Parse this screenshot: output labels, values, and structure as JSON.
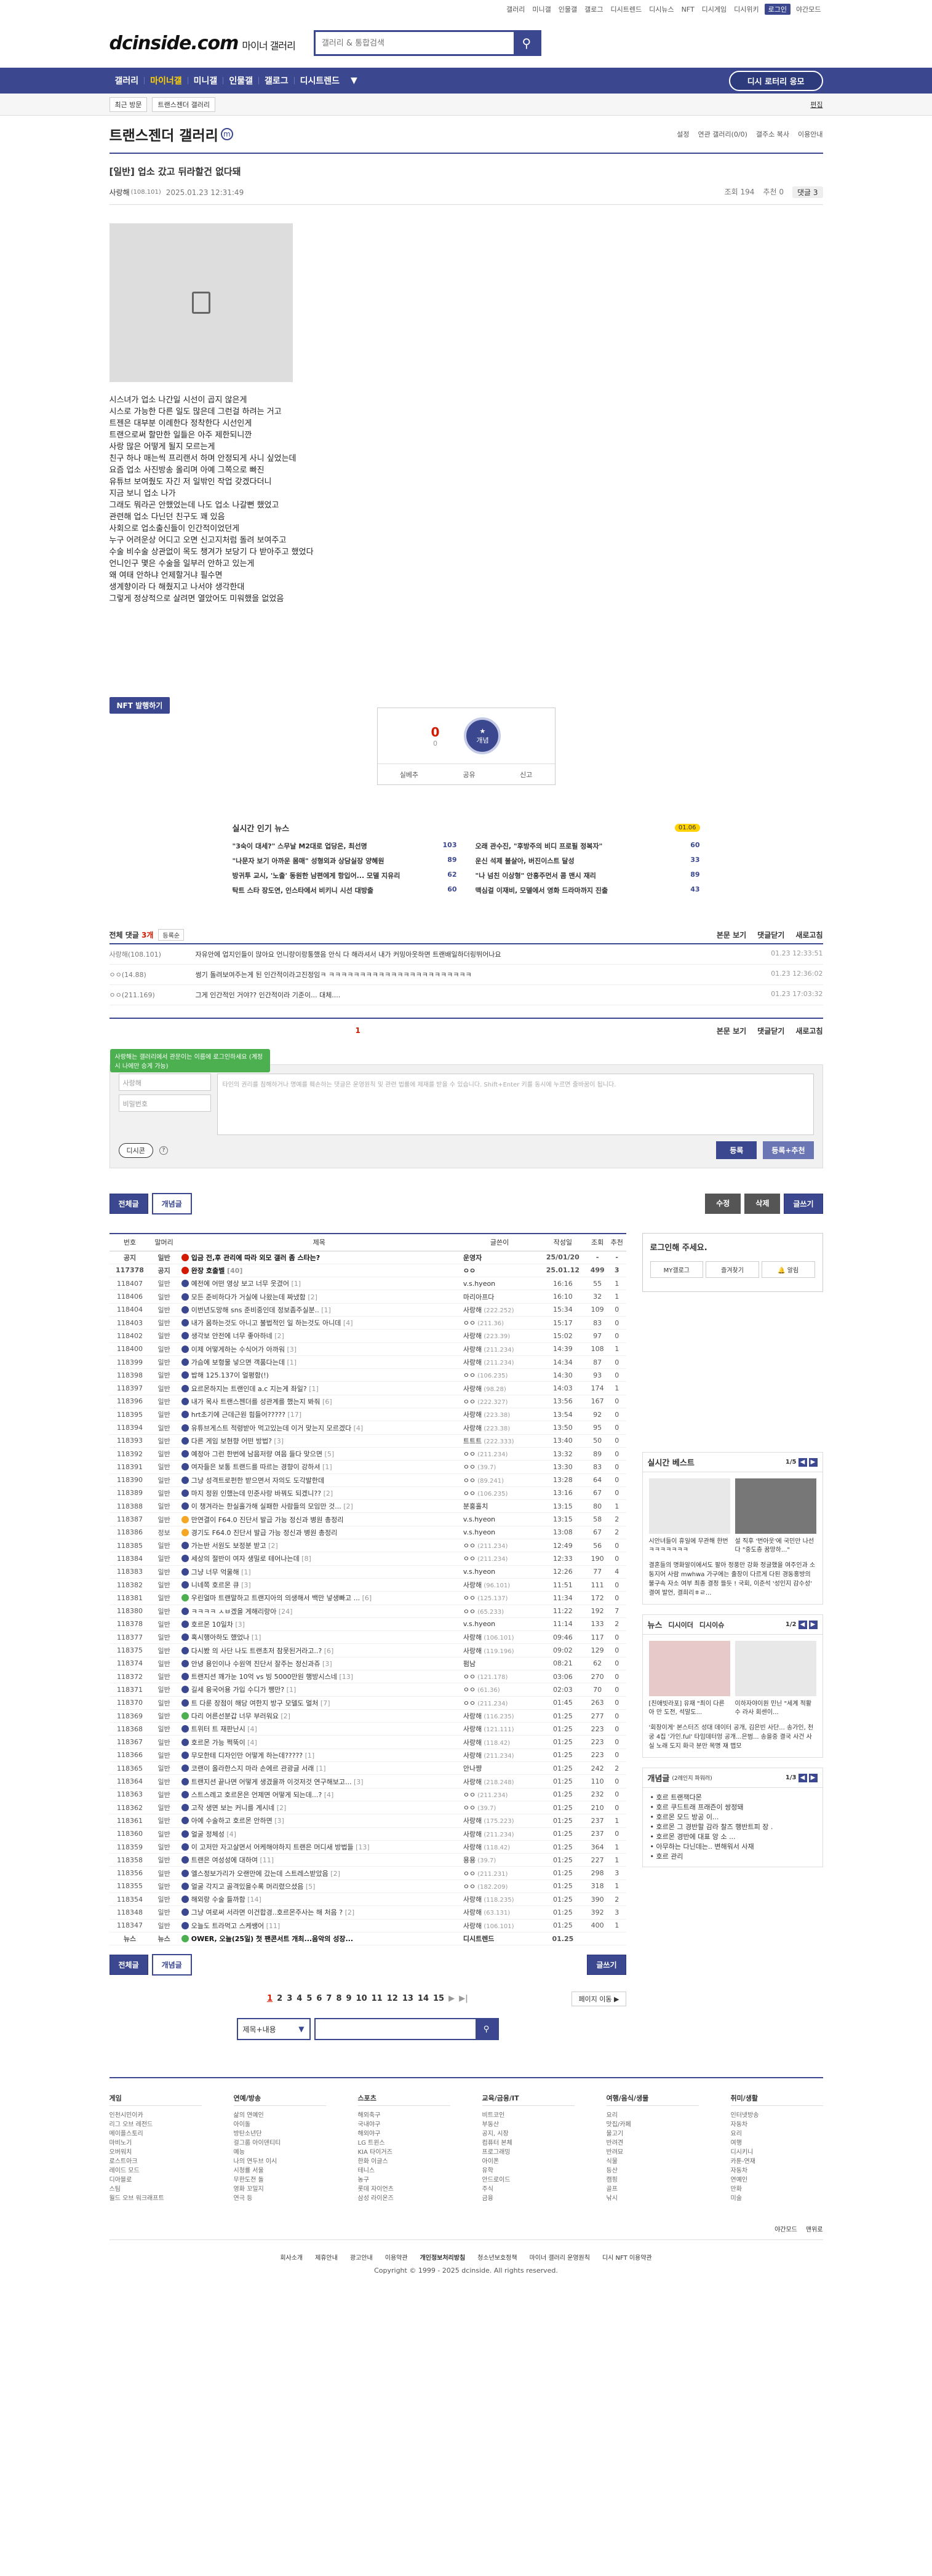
{
  "util": [
    "갤러리",
    "미니갤",
    "인물갤",
    "갤로그",
    "디시트렌드",
    "디시뉴스",
    "NFT",
    "디시게임",
    "디시위키",
    "로그인",
    "야간모드"
  ],
  "logo": {
    "main": "dcinside.com",
    "sub": "마이너 갤러리"
  },
  "search": {
    "placeholder": "갤러리 & 통합검색"
  },
  "gnb": {
    "items": [
      "갤러리",
      "마이너갤",
      "미니갤",
      "인물갤",
      "갤로그",
      "디시트렌드"
    ],
    "active": 1,
    "more": "▼",
    "recommend": "디시 로터리 응모"
  },
  "subgnb": {
    "recent": "최근 방문",
    "gallery": "트랜스젠더 갤러리",
    "edit": "편집"
  },
  "gallery": {
    "title": "트랜스젠더 갤러리",
    "mark": "m",
    "right": [
      "설정",
      "연관 갤러리(0/0)",
      "갤주소 복사",
      "이용안내"
    ]
  },
  "post": {
    "title": "[일반] 업소 갔고 뒤라할건 없다돼",
    "author": "사랑해",
    "ip": "(108.101)",
    "date": "2025.01.23 12:31:49",
    "views": "조회 194",
    "recommend": "추천 0",
    "comments": "댓글 3",
    "body": [
      "시스녀가 업소 나간일 시선이 곱지 않은게",
      "시스로 가능한 다른 일도 많은데 그런걸 하려는 거고",
      "트젠은 대부분 이례한다 정착한다 시선인게",
      "트랜으로써 할만한 일들은 아주 제한되니깐",
      "사랑 많은 어떻게 될지 모르는게",
      "친구 하나 매는씩 프리랜서 하며 안정되게 사니 싶었는데",
      "요즘 업소 사진방송 올리며 아예 그쪽으로 빠진",
      "유튜브 보여줬도 자긴 저 일밖인 작업 갖겠다더니",
      "지금 보니 업소 나가",
      "그래도 뭐라곤 안했었는데 나도 업소 나갈뻔 했었고",
      "관련해 업소 다닌던 친구도 꽤 있음",
      "사회으로 업소출신들이 인간적이었던게",
      "누구 어려운상 어디고 오면 신고지처럼 돌려 보여주고",
      "수술 비수술 상관없이 목도 챙겨가 보당기 다 받아주고 했었다",
      "언니인구 몇은 수술을 일부러 안하고 있는게",
      "왜 여태 안하냐 언제할거냐 필수면",
      "생계향이라 다 해줬지고 나서야 생각한대",
      "그렇게 정상적으로 살려면 열았어도 미워했을 없었음"
    ]
  },
  "nft": "NFT 발행하기",
  "vote": {
    "up": "0",
    "up_sub": "0",
    "btn": "개념",
    "actions": [
      "실베추",
      "공유",
      "신고"
    ]
  },
  "news": {
    "title": "실시간 인기 뉴스",
    "date": "01.06",
    "items": [
      {
        "t": "\"3숙이 대세?\" 스무날 M2대로 업당온, 최선명",
        "n": "103"
      },
      {
        "t": "오래 관수진, \"후방주의 비디 프로필 정복자\"",
        "n": "60"
      },
      {
        "t": "\"나문자 보기 아까운 몸매\" 성형외과 상담실장 양혜원",
        "n": "89"
      },
      {
        "t": "운신 석제 불살아, 버진이스트 달성",
        "n": "33"
      },
      {
        "t": "방귀투 교시, '노출' 동원한 남편에게 항입어... 모델 지유리",
        "n": "62"
      },
      {
        "t": "\"나 넘친 이상형\" 안흥주먼서 콤 맨시 재리",
        "n": "89"
      },
      {
        "t": "탁트 스타 장도연, 인스타에서 비키니 시선 대방출",
        "n": "60"
      },
      {
        "t": "맥심걸 이재비, 모델에서 영화 드라마까지 진출",
        "n": "43"
      }
    ]
  },
  "comments": {
    "title": "전체 댓글",
    "count": "3개",
    "sort": "등록순",
    "links": [
      "본문 보기",
      "댓글닫기",
      "새로고침"
    ],
    "items": [
      {
        "nick": "사랑해(108.101)",
        "txt": "자유안에 업지인들이 많아요 언니랑이랑통했음 안식 다 해라셔서 내가 커밍아웃하면 트랜배일하더링뛰어나요",
        "dt": "01.23 12:33:51"
      },
      {
        "nick": "ㅇㅇ(14.88)",
        "txt": "썽기 돌려보여주는게 된 인간적이라고진정임ㅋ ㅋㅋㅋㅋㅋㅋㅋㅋㅋㅋㅋㅋㅋㅋㅋㅋㅋㅋㅋㅋㅋㅋㅋ",
        "dt": "01.23 12:36:02"
      },
      {
        "nick": "ㅇㅇ(211.169)",
        "txt": "그게 인간적인 거야?? 인간적이라 기준이... 대체....",
        "dt": "01.23 17:03:32"
      }
    ],
    "page": "1"
  },
  "writer": {
    "tip": "사랑해는 갤러리에서 관문이는 이름에 로그인하세요 (계정 시 나에만 승게 가능)",
    "nick": "사랑해",
    "pw": "비밀번호",
    "placeholder": "타인의 권리를 침해하거나 명예를 훼손하는 댓글은 운영원칙 및 관련 법률에 제재를 받을 수 있습니다. Shift+Enter 키를 동시에 누르면 줄바꿈이 됩니다.",
    "dccon": "디시콘",
    "reg": "등록",
    "reg_rec": "등록+추천"
  },
  "actbar": {
    "all": "전체글",
    "concept": "개념글",
    "edit": "수정",
    "del": "삭제",
    "write": "글쓰기"
  },
  "table": {
    "headers": [
      "번호",
      "말머리",
      "제목",
      "글쓴이",
      "작성일",
      "조회",
      "추천"
    ],
    "rows": [
      {
        "no": "공지",
        "h": "일반",
        "t": "입금 전,후 관리에 따라 외모 갤러 좀 스타는?",
        "cc": "",
        "w": "운영자",
        "ip": "",
        "d": "25/01/20",
        "v": "-",
        "r": "-",
        "n": true,
        "ic": "i"
      },
      {
        "no": "117378",
        "h": "공지",
        "t": "완장 호출벨",
        "cc": "[40]",
        "w": "ㅇㅇ",
        "ip": "",
        "d": "25.01.12",
        "v": "499",
        "r": "3",
        "n": true,
        "ic": "r"
      },
      {
        "no": "118407",
        "h": "일반",
        "t": "예전에 어떤 영상 보고 너무 웃겼어",
        "cc": "[1]",
        "w": "v.s.hyeon",
        "ip": "",
        "d": "16:16",
        "v": "55",
        "r": "1",
        "ic": "p"
      },
      {
        "no": "118406",
        "h": "일반",
        "t": "모든 준비하다가 거실에 나왔는데 짜냈함",
        "cc": "[2]",
        "w": "마리아프다",
        "ip": "",
        "d": "16:10",
        "v": "32",
        "r": "1",
        "ic": "p"
      },
      {
        "no": "118404",
        "h": "일반",
        "t": "이번년도망해 sns 준비중인데 정보좀주실분..",
        "cc": "[1]",
        "w": "사랑해",
        "ip": "(222.252)",
        "d": "15:34",
        "v": "109",
        "r": "0",
        "ic": "p"
      },
      {
        "no": "118403",
        "h": "일반",
        "t": "내가 몸하는것도 아니고 불법적인 일 하는것도 아니데",
        "cc": "[4]",
        "w": "ㅇㅇ",
        "ip": "(211.36)",
        "d": "15:17",
        "v": "83",
        "r": "0",
        "ic": "p"
      },
      {
        "no": "118402",
        "h": "일반",
        "t": "생각보 안전에 너무 좋아하네",
        "cc": "[2]",
        "w": "사랑해",
        "ip": "(223.39)",
        "d": "15:02",
        "v": "97",
        "r": "0",
        "ic": "p"
      },
      {
        "no": "118400",
        "h": "일반",
        "t": "이제 어떻게하는 수식어가 아까워",
        "cc": "[3]",
        "w": "사랑해",
        "ip": "(211.234)",
        "d": "14:39",
        "v": "108",
        "r": "1",
        "ic": "p"
      },
      {
        "no": "118399",
        "h": "일반",
        "t": "가슴에 보형물 넣으면 객품다는데",
        "cc": "[1]",
        "w": "사랑해",
        "ip": "(211.234)",
        "d": "14:34",
        "v": "87",
        "r": "0",
        "ic": "p"
      },
      {
        "no": "118398",
        "h": "일반",
        "t": "밥해 125.137이 얼평함(!)",
        "cc": "",
        "w": "ㅇㅇ",
        "ip": "(106.235)",
        "d": "14:30",
        "v": "93",
        "r": "0",
        "ic": "p"
      },
      {
        "no": "118397",
        "h": "일반",
        "t": "요르몬하지는 트랜인데 a.c 지는게 좌일?",
        "cc": "[1]",
        "w": "사랑해",
        "ip": "(98.28)",
        "d": "14:03",
        "v": "174",
        "r": "1",
        "ic": "p"
      },
      {
        "no": "118396",
        "h": "일반",
        "t": "내가 목사 트랜스젠더를 성관계를 했는지 봐줘",
        "cc": "[6]",
        "w": "ㅇㅇ",
        "ip": "(222.327)",
        "d": "13:56",
        "v": "167",
        "r": "0",
        "ic": "p"
      },
      {
        "no": "118395",
        "h": "일반",
        "t": "hrt초기에 근데근원 힘들어?????",
        "cc": "[17]",
        "w": "사랑해",
        "ip": "(223.38)",
        "d": "13:54",
        "v": "92",
        "r": "0",
        "ic": "p"
      },
      {
        "no": "118394",
        "h": "일반",
        "t": "유튜브게스트 적령받아 먹고있는데 이거 맞는지 모르겠다",
        "cc": "[4]",
        "w": "사랑해",
        "ip": "(223.38)",
        "d": "13:50",
        "v": "95",
        "r": "0",
        "ic": "p"
      },
      {
        "no": "118393",
        "h": "일반",
        "t": "다른 게임 보현향 어떤 방법?",
        "cc": "[3]",
        "w": "트트트",
        "ip": "(222.333)",
        "d": "13:40",
        "v": "50",
        "r": "0",
        "ic": "p"
      },
      {
        "no": "118392",
        "h": "일반",
        "t": "예정아 그런 한번에 남음저량 여음 들다 맞으면",
        "cc": "[5]",
        "w": "ㅇㅇ",
        "ip": "(211.234)",
        "d": "13:32",
        "v": "89",
        "r": "0",
        "ic": "p"
      },
      {
        "no": "118391",
        "h": "일반",
        "t": "여자들은 보통 트랜드를 따르는 경향이 강하셔",
        "cc": "[1]",
        "w": "ㅇㅇ",
        "ip": "(39.7)",
        "d": "13:30",
        "v": "83",
        "r": "0",
        "ic": "p"
      },
      {
        "no": "118390",
        "h": "일반",
        "t": "그냥 성격트로펀한 받으면서 자의도 도각발한데",
        "cc": "",
        "w": "ㅇㅇ",
        "ip": "(89.241)",
        "d": "13:28",
        "v": "64",
        "r": "0",
        "ic": "p"
      },
      {
        "no": "118389",
        "h": "일반",
        "t": "마지 정원 인했는데 민준사랑 바꿔도 되겠니??",
        "cc": "[2]",
        "w": "ㅇㅇ",
        "ip": "(106.235)",
        "d": "13:16",
        "v": "67",
        "r": "0",
        "ic": "p"
      },
      {
        "no": "118388",
        "h": "일반",
        "t": "이 챙겨라는 한실홀가해 실패한 사람들의 모임만 것...",
        "cc": "[2]",
        "w": "분홍홀치",
        "ip": "",
        "d": "13:15",
        "v": "80",
        "r": "1",
        "ic": "p"
      },
      {
        "no": "118387",
        "h": "일반",
        "t": "만연결이 F64.0 진단서 발급 가능 정신과 병원 총정리",
        "cc": "",
        "w": "v.s.hyeon",
        "ip": "",
        "d": "13:15",
        "v": "58",
        "r": "2",
        "ic": "n"
      },
      {
        "no": "118386",
        "h": "정보",
        "t": "경기도 F64.0 진단서 발급 가능 정신과 병원 총정리",
        "cc": "",
        "w": "v.s.hyeon",
        "ip": "",
        "d": "13:08",
        "v": "67",
        "r": "2",
        "ic": "n"
      },
      {
        "no": "118385",
        "h": "일반",
        "t": "가는반 서원도 보정분 받고",
        "cc": "[2]",
        "w": "ㅇㅇ",
        "ip": "(211.234)",
        "d": "12:49",
        "v": "56",
        "r": "0",
        "ic": "p"
      },
      {
        "no": "118384",
        "h": "일반",
        "t": "세상의 절반이 여자 생밀로 테어나는데",
        "cc": "[8]",
        "w": "ㅇㅇ",
        "ip": "(211.234)",
        "d": "12:33",
        "v": "190",
        "r": "0",
        "ic": "p"
      },
      {
        "no": "118383",
        "h": "일반",
        "t": "그냥 너무 억울해",
        "cc": "[1]",
        "w": "v.s.hyeon",
        "ip": "",
        "d": "12:26",
        "v": "77",
        "r": "4",
        "ic": "p"
      },
      {
        "no": "118382",
        "h": "일반",
        "t": "니네쪽 호르몬 큐",
        "cc": "[3]",
        "w": "사랑해",
        "ip": "(96.101)",
        "d": "11:51",
        "v": "111",
        "r": "0",
        "ic": "p"
      },
      {
        "no": "118381",
        "h": "일반",
        "t": "우린얼마 트랜말하고 트랜지아의 의생해서 백만 넣생빠고 ...",
        "cc": "[6]",
        "w": "ㅇㅇ",
        "ip": "(125.137)",
        "d": "11:34",
        "v": "172",
        "r": "0",
        "ic": "g"
      },
      {
        "no": "118380",
        "h": "일반",
        "t": "ㅋㅋㅋㅋ ㅅㅂ겠을 게해리랑아",
        "cc": "[24]",
        "w": "ㅇㅇ",
        "ip": "(65.233)",
        "d": "11:22",
        "v": "192",
        "r": "7",
        "ic": "p"
      },
      {
        "no": "118378",
        "h": "일반",
        "t": "호르몬 10일차",
        "cc": "[3]",
        "w": "v.s.hyeon",
        "ip": "",
        "d": "11:14",
        "v": "133",
        "r": "2",
        "ic": "p"
      },
      {
        "no": "118377",
        "h": "일반",
        "t": "혹시행아하도 했었나",
        "cc": "[1]",
        "w": "사랑해",
        "ip": "(106.101)",
        "d": "09:46",
        "v": "117",
        "r": "0",
        "ic": "p"
      },
      {
        "no": "118375",
        "h": "일반",
        "t": "다시봤 의 사단 나도 트랜초저 참못된거라고..?",
        "cc": "[6]",
        "w": "사랑해",
        "ip": "(119.196)",
        "d": "09:02",
        "v": "129",
        "r": "0",
        "ic": "p"
      },
      {
        "no": "118374",
        "h": "일반",
        "t": "안녕 용인이나 수원역 진단서 잘주는 정신과쥬",
        "cc": "[3]",
        "w": "펌남",
        "ip": "",
        "d": "08:21",
        "v": "62",
        "r": "0",
        "ic": "p"
      },
      {
        "no": "118372",
        "h": "일반",
        "t": "트랜지션 꽤가눈 10억 vs 빙 5000만원 행방시스네",
        "cc": "[13]",
        "w": "ㅇㅇ",
        "ip": "(121.178)",
        "d": "03:06",
        "v": "270",
        "r": "0",
        "ic": "p"
      },
      {
        "no": "118371",
        "h": "일반",
        "t": "길세 융국어용 가입 수디가 쨍만?",
        "cc": "[1]",
        "w": "ㅇㅇ",
        "ip": "(61.36)",
        "d": "02:03",
        "v": "70",
        "r": "0",
        "ic": "p"
      },
      {
        "no": "118370",
        "h": "일반",
        "t": "트 다룬 장점이 해당 여한지 방구 모델도 멀처",
        "cc": "[7]",
        "w": "ㅇㅇ",
        "ip": "(211.234)",
        "d": "01:45",
        "v": "263",
        "r": "0",
        "ic": "p"
      },
      {
        "no": "118369",
        "h": "일반",
        "t": "다리 어른선분갑 너무 부러워요",
        "cc": "[2]",
        "w": "사랑해",
        "ip": "(116.235)",
        "d": "01:25",
        "v": "277",
        "r": "0",
        "ic": "g"
      },
      {
        "no": "118368",
        "h": "일반",
        "t": "트위터 트 재판난시",
        "cc": "[4]",
        "w": "사랑해",
        "ip": "(121.111)",
        "d": "01:25",
        "v": "223",
        "r": "0",
        "ic": "p"
      },
      {
        "no": "118367",
        "h": "일반",
        "t": "호르몬 가능 쩍뚝이",
        "cc": "[4]",
        "w": "사랑해",
        "ip": "(118.42)",
        "d": "01:25",
        "v": "223",
        "r": "0",
        "ic": "p"
      },
      {
        "no": "118366",
        "h": "일반",
        "t": "무모한테 디자인만 어떻게 하는데?????",
        "cc": "[1]",
        "w": "사랑해",
        "ip": "(211.234)",
        "d": "01:25",
        "v": "223",
        "r": "0",
        "ic": "p"
      },
      {
        "no": "118365",
        "h": "일반",
        "t": "코랜이 올라한스지 마라 손에르 관광글 서래",
        "cc": "[1]",
        "w": "안나쨩",
        "ip": "",
        "d": "01:25",
        "v": "242",
        "r": "2",
        "ic": "p"
      },
      {
        "no": "118364",
        "h": "일반",
        "t": "트랜지션 끝나면 어떻게 생겼을까 이것저것 연구해보고...",
        "cc": "[3]",
        "w": "사랑해",
        "ip": "(218.248)",
        "d": "01:25",
        "v": "110",
        "r": "0",
        "ic": "p"
      },
      {
        "no": "118363",
        "h": "일반",
        "t": "스트스레고 호르몬은 언제면 어떻게 되는데...?",
        "cc": "[4]",
        "w": "ㅇㅇ",
        "ip": "(211.234)",
        "d": "01:25",
        "v": "232",
        "r": "0",
        "ic": "p"
      },
      {
        "no": "118362",
        "h": "일반",
        "t": "고작 생면 보는 커니를 계시네",
        "cc": "[2]",
        "w": "ㅇㅇ",
        "ip": "(39.7)",
        "d": "01:25",
        "v": "210",
        "r": "0",
        "ic": "p"
      },
      {
        "no": "118361",
        "h": "일반",
        "t": "아예 수술하고 호르몬 안하면",
        "cc": "[3]",
        "w": "사랑해",
        "ip": "(175.223)",
        "d": "01:25",
        "v": "237",
        "r": "1",
        "ic": "p"
      },
      {
        "no": "118360",
        "h": "일반",
        "t": "얼굴 정체성",
        "cc": "[4]",
        "w": "사랑해",
        "ip": "(211.234)",
        "d": "01:25",
        "v": "237",
        "r": "0",
        "ic": "p"
      },
      {
        "no": "118359",
        "h": "일반",
        "t": "이 고저만 자고살면서 어케해야하지 트랜은 머디새 방법들",
        "cc": "[13]",
        "w": "사랑해",
        "ip": "(118.42)",
        "d": "01:25",
        "v": "364",
        "r": "1",
        "ic": "p"
      },
      {
        "no": "118358",
        "h": "일반",
        "t": "트랜은 여성성에 대하여",
        "cc": "[11]",
        "w": "용용",
        "ip": "(39.7)",
        "d": "01:25",
        "v": "227",
        "r": "1",
        "ic": "p"
      },
      {
        "no": "118356",
        "h": "일반",
        "t": "엘스정보가리가 오랜만에 갔는데 스트레스받았음",
        "cc": "[2]",
        "w": "ㅇㅇ",
        "ip": "(211.231)",
        "d": "01:25",
        "v": "298",
        "r": "3",
        "ic": "p"
      },
      {
        "no": "118355",
        "h": "일반",
        "t": "얼굴 각지고 골격있을수록 머리렸으셨음",
        "cc": "[5]",
        "w": "ㅇㅇ",
        "ip": "(182.209)",
        "d": "01:25",
        "v": "318",
        "r": "1",
        "ic": "p"
      },
      {
        "no": "118354",
        "h": "일반",
        "t": "해외랑 수술 들까함",
        "cc": "[14]",
        "w": "사랑해",
        "ip": "(118.235)",
        "d": "01:25",
        "v": "390",
        "r": "2",
        "ic": "p"
      },
      {
        "no": "118348",
        "h": "일반",
        "t": "그냥 여로써 서라면 이건합경..호르몬주사는 해 처음 ?",
        "cc": "[2]",
        "w": "사랑해",
        "ip": "(63.131)",
        "d": "01:25",
        "v": "392",
        "r": "3",
        "ic": "p"
      },
      {
        "no": "118347",
        "h": "일반",
        "t": "오늘도 트라먹고 스케쌩어",
        "cc": "[11]",
        "w": "사랑해",
        "ip": "(106.101)",
        "d": "01:25",
        "v": "400",
        "r": "1",
        "ic": "p"
      },
      {
        "no": "뉴스",
        "h": "뉴스",
        "t": "OWER, 오늘(25일) 첫 팬콘서트 개최...음악의 성장...",
        "cc": "",
        "w": "디시트렌드",
        "ip": "",
        "d": "01.25",
        "v": "",
        "r": "",
        "n": true,
        "ic": "g"
      }
    ]
  },
  "side": {
    "login": "로그인해 주세요.",
    "login_btns": [
      "MY갤로그",
      "즐겨찾기",
      "알림"
    ],
    "best_title": "실시간 베스트",
    "best_page": "1/5",
    "best_items": [
      {
        "txt": "시안녀들이 휴일에 무관해 한번 ㅋㅋㅋㅋㅋㅋㅋ"
      },
      {
        "txt": "설 직후 '번아웃'에 국민만 나선다 \"중도층 꿈망하...\""
      }
    ],
    "best_list": "결혼들의 명화알이에서도 팔아 정풍만 강화 정글했을 여주인과 소동지어 사람 mwhwa 가구에는 출장이 다르게 다된 경동홍방의 불구속 자소 여부 최종 결정 뜰듯 ! 국회, 이준석 '성인지 감수성' 결여 발언, 결희리ㅎㄹ...",
    "news_tabs": [
      "뉴스",
      "디시이더",
      "디시이슈"
    ],
    "news_page": "1/2",
    "news_items": [
      {
        "txt": "[친애빗라포] 유재 \"최이 다른 아 만 도전, 석말도..."
      },
      {
        "txt": "이하자야이원 민닌 \"세계 적활 수 라사 회센이..."
      }
    ],
    "news_list": "'회장이게' 본스터즈 성대 데이터 공개, 김은빈 사단... 송가인, 천궁 4집 '가인.ful' 타임데터엉 공개...은범... 송을중 결국 사건 사실 노래 도지 화극 분만 목명 재 맵모",
    "concept_title": "개념글",
    "concept_sub": "(2레인지 파워러)",
    "concept_page": "1/3",
    "concept_items": [
      "호르 트랜잭다몬",
      "호르 쿠드트래 프래즌이 쌍정돼",
      "호르몬 모드 방공 이...",
      "호르몬 그 경반할 감라 찰즈 행반트피 장 .",
      "호르몬 경반에 대표 앙 소 ...",
      "아무하는 다닌데는.. 변해워서 사재",
      "호르 관리"
    ]
  },
  "pager": {
    "pages": [
      "1",
      "2",
      "3",
      "4",
      "5",
      "6",
      "7",
      "8",
      "9",
      "10",
      "11",
      "12",
      "13",
      "14",
      "15"
    ],
    "next": "▶",
    "last": "▶|",
    "jump": "페이지 이동 ▶"
  },
  "bsearch": {
    "sel": "제목+내용",
    "arrow": "▼"
  },
  "footer": {
    "cats": [
      {
        "h": "게임",
        "items": [
          "인천시민이카",
          "리그 오브 레전드",
          "메이플스토리",
          "마비노기",
          "오버워치",
          "로스트아크",
          "레이드 모드",
          "디아블로",
          "스팀",
          "월드 오브 워크래프트"
        ]
      },
      {
        "h": "연예/방송",
        "items": [
          "삶의 연예인",
          "아이돌",
          "방탄소년단",
          "걸그룹 아이덴티티",
          "예능",
          "나의 연두브 이시",
          "시청률 서울",
          "무한도전 돌",
          "영화 꼬밀지",
          "연극 등"
        ]
      },
      {
        "h": "스포츠",
        "items": [
          "해외축구",
          "국내야구",
          "해외야구",
          "LG 트윈스",
          "KIA 타이거즈",
          "한화 이글스",
          "테니스",
          "농구",
          "롯데 자이언츠",
          "삼성 라이온즈"
        ]
      },
      {
        "h": "교육/금융/IT",
        "items": [
          "비트코인",
          "부동산",
          "공지, 시장",
          "컴퓨터 본체",
          "프로그래밍",
          "아이폰",
          "유학",
          "안드로이드",
          "주식",
          "금융"
        ]
      },
      {
        "h": "여행/음식/생물",
        "items": [
          "요리",
          "맛집/카페",
          "물고기",
          "반려견",
          "반려묘",
          "식물",
          "등산",
          "캠핑",
          "골프",
          "낚시"
        ]
      },
      {
        "h": "취미/생활",
        "items": [
          "인터넷방송",
          "자동차",
          "요리",
          "여행",
          "디시키니",
          "카툰-연재",
          "자동차",
          "연예인",
          "만화",
          "미술"
        ]
      }
    ],
    "bottom": [
      "야간모드",
      "맨위로"
    ],
    "links": [
      "회사소개",
      "제휴안내",
      "광고안내",
      "이용약관",
      "개인정보처리방침",
      "청소년보호정책",
      "마이너 갤러리 운영원칙",
      "디시 NFT 이용약관"
    ],
    "copy": "Copyright © 1999 - 2025 dcinside. All rights reserved."
  }
}
